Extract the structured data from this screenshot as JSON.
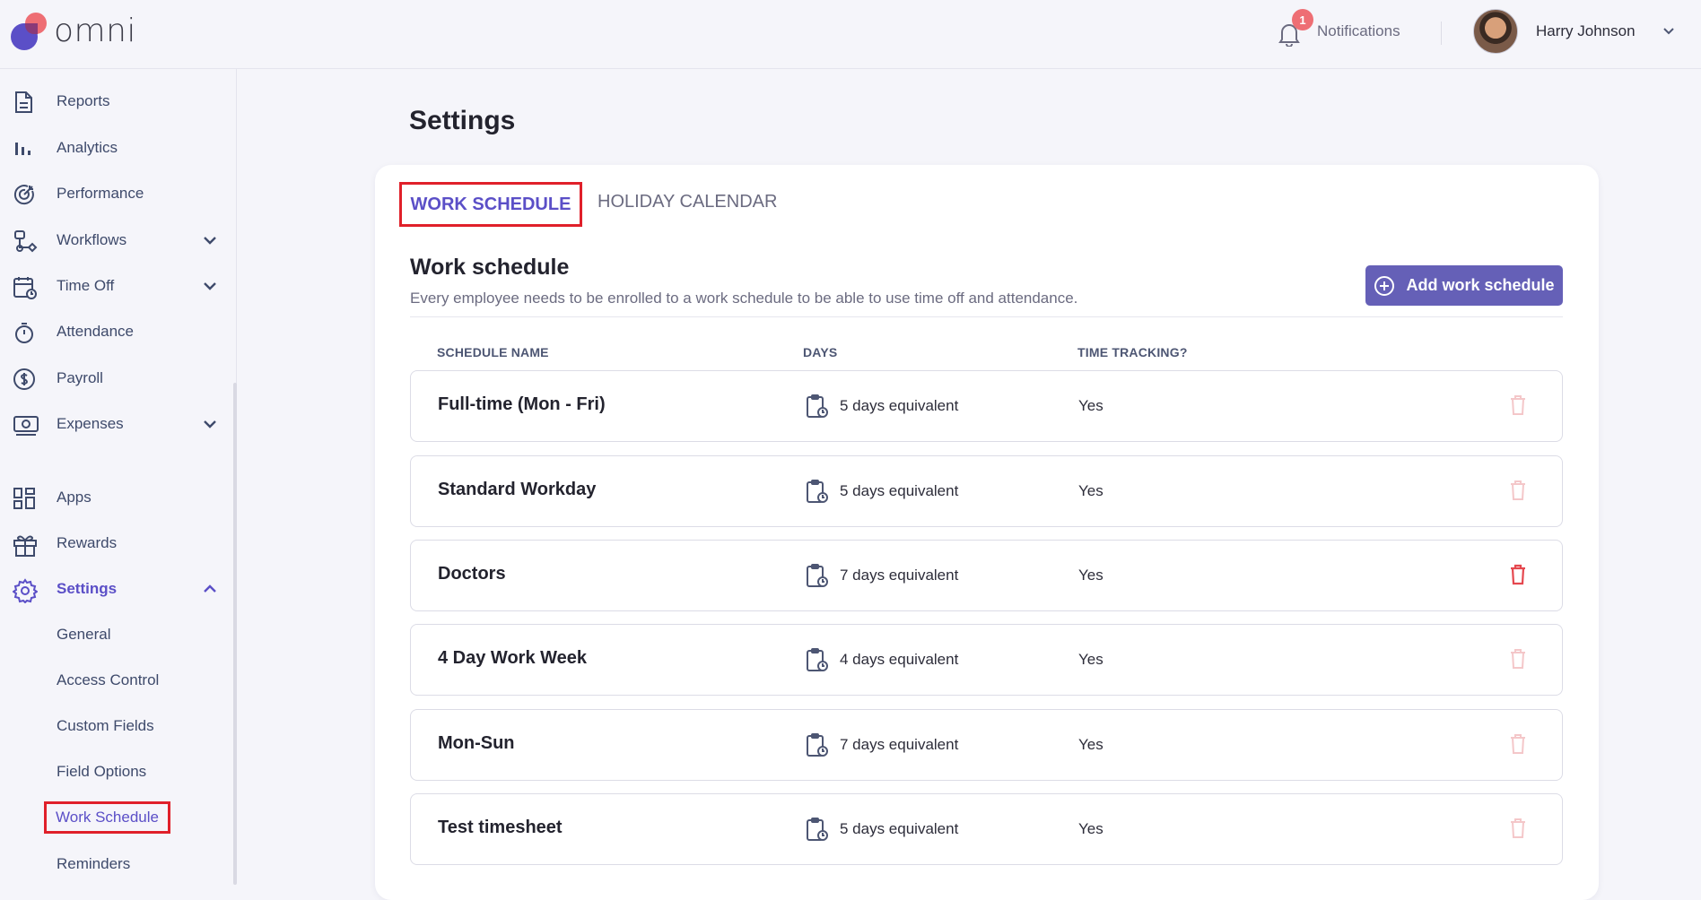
{
  "app": {
    "logo_text": "omni",
    "brand_color": "#5b4fc7",
    "accent_color": "#ee6e74"
  },
  "header": {
    "notifications_label": "Notifications",
    "notifications_count": "1",
    "user_name": "Harry Johnson"
  },
  "sidebar": {
    "items": [
      {
        "label": "Reports",
        "icon": "document-icon"
      },
      {
        "label": "Analytics",
        "icon": "bar-chart-icon"
      },
      {
        "label": "Performance",
        "icon": "target-icon"
      },
      {
        "label": "Workflows",
        "icon": "workflow-icon",
        "expandable": true
      },
      {
        "label": "Time Off",
        "icon": "calendar-clock-icon",
        "expandable": true
      },
      {
        "label": "Attendance",
        "icon": "stopwatch-icon"
      },
      {
        "label": "Payroll",
        "icon": "dollar-icon"
      },
      {
        "label": "Expenses",
        "icon": "cash-icon",
        "expandable": true
      },
      {
        "label": "Apps",
        "icon": "grid-icon"
      },
      {
        "label": "Rewards",
        "icon": "gift-icon"
      },
      {
        "label": "Settings",
        "icon": "gear-icon",
        "expanded": true,
        "active": true
      }
    ],
    "settings_sub": [
      {
        "label": "General"
      },
      {
        "label": "Access Control"
      },
      {
        "label": "Custom Fields"
      },
      {
        "label": "Field Options"
      },
      {
        "label": "Work Schedule",
        "current": true
      },
      {
        "label": "Reminders"
      }
    ]
  },
  "main": {
    "page_title": "Settings",
    "tabs": [
      {
        "label": "WORK SCHEDULE",
        "active": true
      },
      {
        "label": "HOLIDAY CALENDAR",
        "active": false
      }
    ],
    "section_title": "Work schedule",
    "section_desc": "Every employee needs to be enrolled to a work schedule to be able to use time off and attendance.",
    "add_button": "Add work schedule",
    "table": {
      "headers": [
        "SCHEDULE NAME",
        "DAYS",
        "TIME TRACKING?"
      ],
      "rows": [
        {
          "name": "Full-time (Mon - Fri)",
          "days": "5 days equivalent",
          "time_tracking": "Yes",
          "delete_enabled": false
        },
        {
          "name": "Standard Workday",
          "days": "5 days equivalent",
          "time_tracking": "Yes",
          "delete_enabled": false
        },
        {
          "name": "Doctors",
          "days": "7 days equivalent",
          "time_tracking": "Yes",
          "delete_enabled": true
        },
        {
          "name": "4 Day Work Week",
          "days": "4 days equivalent",
          "time_tracking": "Yes",
          "delete_enabled": false
        },
        {
          "name": "Mon-Sun",
          "days": "7 days equivalent",
          "time_tracking": "Yes",
          "delete_enabled": false
        },
        {
          "name": "Test timesheet",
          "days": "5 days equivalent",
          "time_tracking": "Yes",
          "delete_enabled": false
        }
      ]
    }
  }
}
